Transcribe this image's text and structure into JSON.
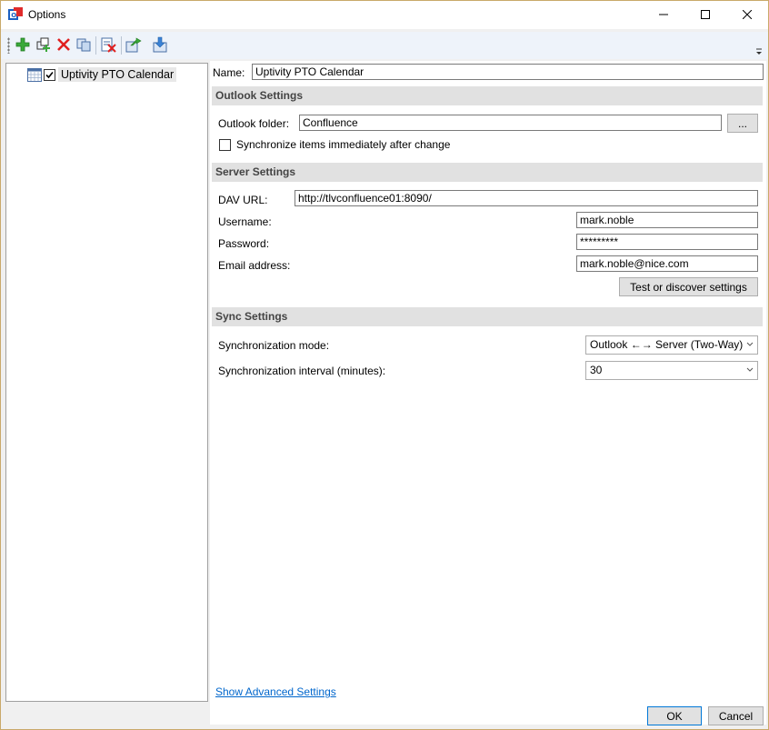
{
  "window": {
    "title": "Options",
    "controls": [
      "minimize",
      "maximize",
      "close"
    ]
  },
  "toolbar": {
    "buttons": [
      "add-icon",
      "add-multiple-icon",
      "delete-icon",
      "copy-icon",
      "clear-cache-icon",
      "export-icon",
      "import-icon"
    ]
  },
  "tree": {
    "nodes": [
      {
        "label": "Uptivity PTO Calendar",
        "checked": true,
        "icon": "calendar-icon"
      }
    ]
  },
  "profile": {
    "name_label": "Name:",
    "name_value": "Uptivity PTO Calendar"
  },
  "outlook": {
    "section_title": "Outlook Settings",
    "folder_label": "Outlook folder:",
    "folder_value": "Confluence",
    "browse_label": "...",
    "sync_immediately_label": "Synchronize items immediately after change",
    "sync_immediately_checked": false
  },
  "server": {
    "section_title": "Server Settings",
    "dav_url_label": "DAV URL:",
    "dav_url_value": "http://tlvconfluence01:8090/",
    "username_label": "Username:",
    "username_value": "mark.noble",
    "password_label": "Password:",
    "password_value": "*********",
    "email_label": "Email address:",
    "email_value": "mark.noble@nice.com",
    "test_button_label": "Test or discover settings"
  },
  "sync": {
    "section_title": "Sync Settings",
    "mode_label": "Synchronization mode:",
    "mode_value": "Outlook ←→ Server (Two-Way)",
    "interval_label": "Synchronization interval (minutes):",
    "interval_value": "30"
  },
  "footer": {
    "advanced_link": "Show Advanced Settings",
    "ok_label": "OK",
    "cancel_label": "Cancel"
  },
  "colors": {
    "accent": "#0078d7",
    "link": "#0066cc",
    "section_bg": "#e1e1e1",
    "toolbar_bg": "#eef3fa"
  }
}
